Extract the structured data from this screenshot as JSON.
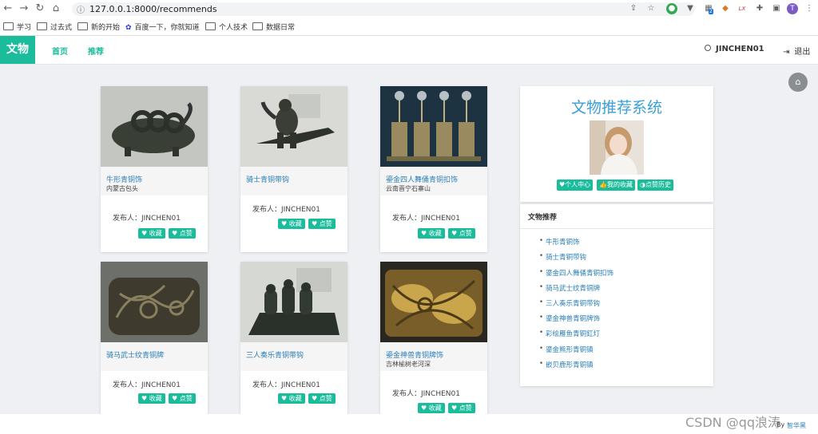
{
  "browser": {
    "url": "127.0.0.1:8000/recommends",
    "bookmarks": [
      "学习",
      "过去式",
      "新的开始",
      "百度一下，你就知道",
      "个人技术",
      "数据日常"
    ],
    "ext_badge": "2",
    "ext_lx": "LX",
    "profile_letter": "T"
  },
  "navbar": {
    "brand": "文物",
    "links": [
      "首页",
      "推荐"
    ],
    "user": "JINCHEN01",
    "logout": "退出"
  },
  "cards": [
    {
      "title": "牛形青铜饰",
      "location": "内蒙古包头",
      "publisher": "发布人：JINCHEN01",
      "fav": "♥ 收藏",
      "like": "♥ 点赞"
    },
    {
      "title": "骑士青铜带钩",
      "location": "",
      "publisher": "发布人：JINCHEN01",
      "fav": "♥ 收藏",
      "like": "♥ 点赞"
    },
    {
      "title": "鎏金四人舞俑青铜扣饰",
      "location": "云南晋宁石寨山",
      "publisher": "发布人：JINCHEN01",
      "fav": "♥ 收藏",
      "like": "♥ 点赞"
    },
    {
      "title": "骑马武士纹青铜牌",
      "location": "",
      "publisher": "发布人：JINCHEN01",
      "fav": "♥ 收藏",
      "like": "♥ 点赞"
    },
    {
      "title": "三人奏乐青铜带钩",
      "location": "",
      "publisher": "发布人：JINCHEN01",
      "fav": "♥ 收藏",
      "like": "♥ 点赞"
    },
    {
      "title": "鎏金神兽青铜牌饰",
      "location": "吉林榆树老河深",
      "publisher": "发布人：JINCHEN01",
      "fav": "♥ 收藏",
      "like": "♥ 点赞"
    }
  ],
  "sidebar": {
    "title": "文物推荐系统",
    "buttons": [
      "♥个人中心",
      "👍我的收藏",
      "◑点赞历史"
    ],
    "rec_heading": "文物推荐",
    "rec_items": [
      "牛形青铜饰",
      "骑士青铜带钩",
      "鎏金四人舞俑青铜扣饰",
      "骑马武士纹青铜牌",
      "三人奏乐青铜带钩",
      "鎏金神兽青铜牌饰",
      "彩绘雁鱼青铜釭灯",
      "鎏金熊形青铜镇",
      "嵌贝鹿形青铜镇"
    ]
  },
  "footer": {
    "by": "By",
    "link": "智华黑",
    "watermark": "CSDN @qq浪涛"
  }
}
